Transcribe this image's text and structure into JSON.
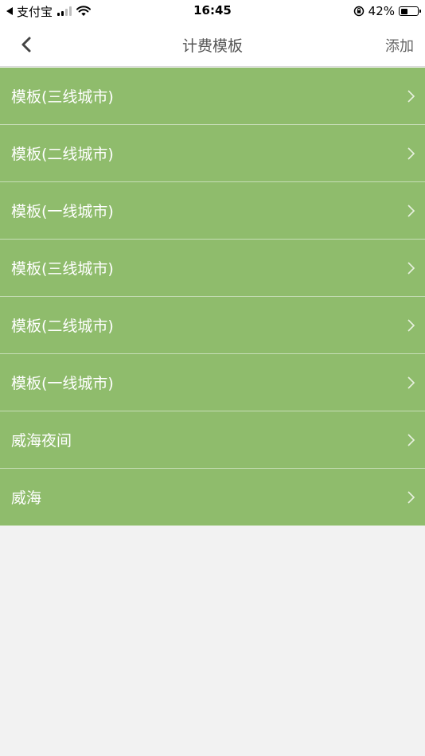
{
  "status_bar": {
    "carrier": "支付宝",
    "time": "16:45",
    "battery_text": "42%",
    "battery_level": 0.42
  },
  "nav": {
    "title": "计费模板",
    "add_label": "添加"
  },
  "list": {
    "items": [
      {
        "label": "模板(三线城市)"
      },
      {
        "label": "模板(二线城市)"
      },
      {
        "label": "模板(一线城市)"
      },
      {
        "label": "模板(三线城市)"
      },
      {
        "label": "模板(二线城市)"
      },
      {
        "label": "模板(一线城市)"
      },
      {
        "label": "威海夜间"
      },
      {
        "label": "威海"
      }
    ]
  },
  "colors": {
    "row_background": "#8fbc6c",
    "page_background": "#f2f2f2"
  }
}
